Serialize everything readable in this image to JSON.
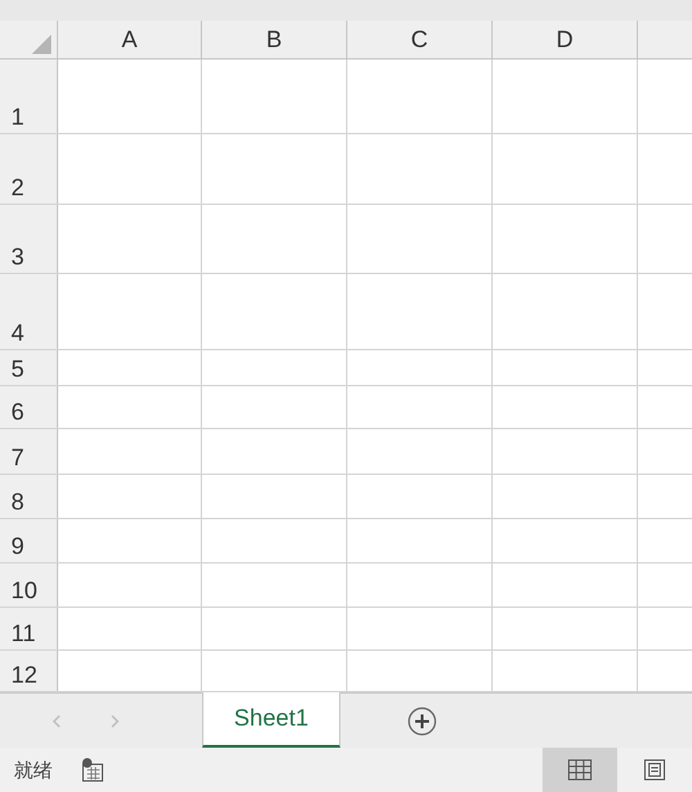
{
  "columns": [
    "A",
    "B",
    "C",
    "D"
  ],
  "rows": [
    "1",
    "2",
    "3",
    "4",
    "5",
    "6",
    "7",
    "8",
    "9",
    "10",
    "11",
    "12"
  ],
  "sheet_tabs": [
    {
      "label": "Sheet1",
      "selected": true
    }
  ],
  "status_bar": {
    "text": "就绪",
    "views": [
      {
        "kind": "normal",
        "selected": true
      },
      {
        "kind": "page-layout",
        "selected": false
      }
    ]
  }
}
